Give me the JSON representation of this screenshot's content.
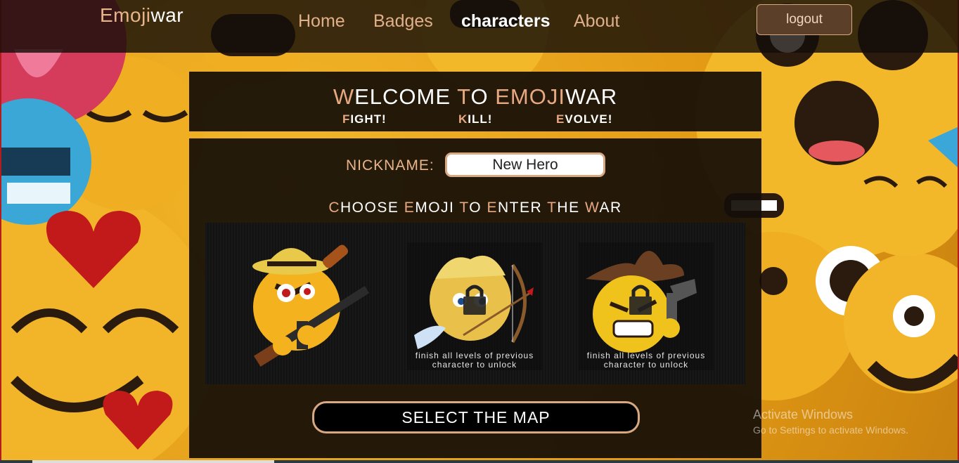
{
  "brand": {
    "part1": "Emoji",
    "part2": "war"
  },
  "nav": {
    "home": "Home",
    "badges": "Badges",
    "characters": "characters",
    "about": "About",
    "logout": "logout"
  },
  "welcome": {
    "title_w": "W",
    "title_rest1": "ELCOME ",
    "title_t": "T",
    "title_rest2": "O ",
    "title_e": "E",
    "title_rest3": "MOJI",
    "title_rest4": "WAR",
    "fight_f": "F",
    "fight_rest": "IGHT!",
    "kill_k": "K",
    "kill_rest": "ILL!",
    "evolve_e": "E",
    "evolve_rest": "VOLVE!"
  },
  "form": {
    "nickname_label": "NICKNAME:",
    "nickname_value": "New Hero"
  },
  "choose": {
    "c": "C",
    "hoose": "HOOSE ",
    "e1": "E",
    "moji": "MOJI ",
    "t": "T",
    "o": "O ",
    "e2": "E",
    "nter": "NTER ",
    "t2": "T",
    "he": "HE ",
    "w": "W",
    "ar": "AR"
  },
  "characters": [
    {
      "name": "gangster-emoji",
      "locked": false,
      "note": ""
    },
    {
      "name": "cupid-emoji",
      "locked": true,
      "note_line1": "finish all levels of previous",
      "note_line2": "character to unlock"
    },
    {
      "name": "cowboy-emoji",
      "locked": true,
      "note_line1": "finish all levels of previous",
      "note_line2": "character to unlock"
    }
  ],
  "select_map": "SELECT THE MAP",
  "watermark": {
    "line1": "Activate Windows",
    "line2": "Go to Settings to activate Windows."
  },
  "colors": {
    "accent": "#e8a882",
    "panel": "#140e08",
    "emoji_yellow": "#f3b72a"
  }
}
